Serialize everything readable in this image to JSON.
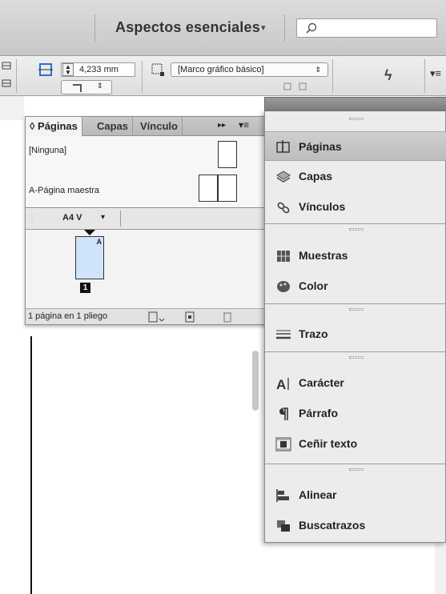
{
  "titlebar": {
    "workspace": "Aspectos esenciales",
    "workspace_caret": "▾",
    "search_placeholder": ""
  },
  "controlbar": {
    "stroke_weight": "4,233 mm",
    "object_style": "[Marco gráfico básico]"
  },
  "pages_panel": {
    "tabs": [
      {
        "label": "◊ Páginas",
        "active": true
      },
      {
        "label": "Capas",
        "active": false
      },
      {
        "label": "Vínculo",
        "active": false
      }
    ],
    "masters": [
      {
        "label": "[Ninguna]"
      },
      {
        "label": "A-Página maestra"
      }
    ],
    "page_size": "A4 V",
    "page_master_letter": "A",
    "page_number": "1",
    "status": "1 página en 1 pliego"
  },
  "dock": {
    "groups": [
      [
        {
          "label": "Páginas",
          "icon": "pages-icon",
          "selected": true
        },
        {
          "label": "Capas",
          "icon": "layers-icon",
          "selected": false
        },
        {
          "label": "Vínculos",
          "icon": "links-icon",
          "selected": false
        }
      ],
      [
        {
          "label": "Muestras",
          "icon": "swatches-icon",
          "selected": false
        },
        {
          "label": "Color",
          "icon": "color-icon",
          "selected": false
        }
      ],
      [
        {
          "label": "Trazo",
          "icon": "stroke-icon",
          "selected": false
        }
      ],
      [
        {
          "label": "Carácter",
          "icon": "character-icon",
          "selected": false
        },
        {
          "label": "Párrafo",
          "icon": "paragraph-icon",
          "selected": false
        },
        {
          "label": "Ceñir texto",
          "icon": "text-wrap-icon",
          "selected": false
        }
      ],
      [
        {
          "label": "Alinear",
          "icon": "align-icon",
          "selected": false
        },
        {
          "label": "Buscatrazos",
          "icon": "pathfinder-icon",
          "selected": false
        }
      ]
    ]
  },
  "colors": {
    "accent_page_fill": "#cfe3fb",
    "selected_row": "#c6c6c6"
  }
}
